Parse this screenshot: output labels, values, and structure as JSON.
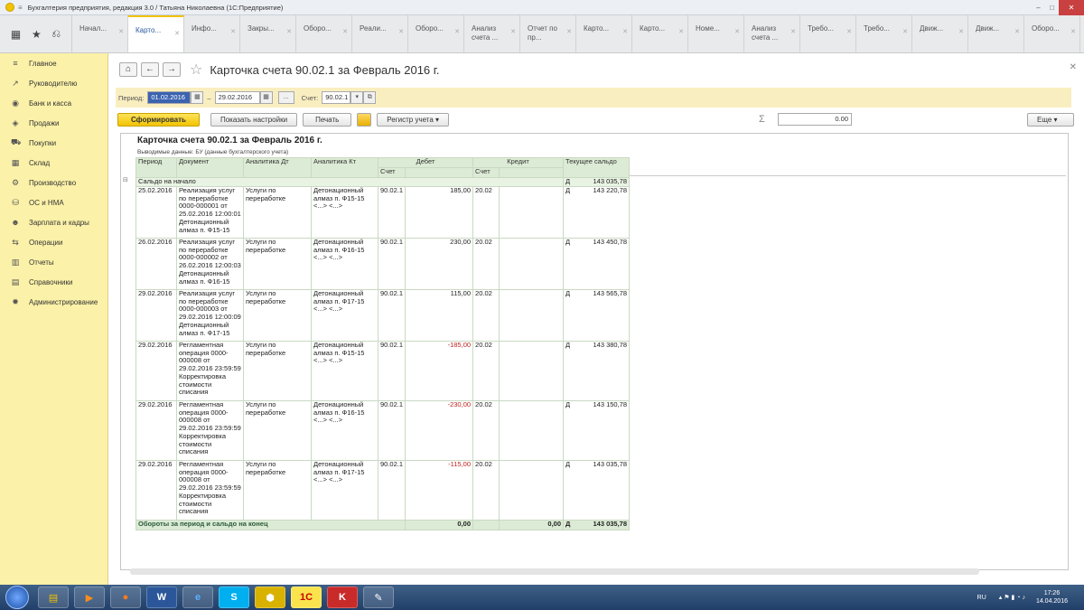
{
  "window": {
    "title": "Бухгалтерия предприятия, редакция 3.0 / Татьяна Николаевна  (1С:Предприятие)"
  },
  "tabs": [
    {
      "label": "Начал..."
    },
    {
      "label": "Картo..."
    },
    {
      "label": "Инфо..."
    },
    {
      "label": "Закры..."
    },
    {
      "label": "Оборо..."
    },
    {
      "label": "Реали..."
    },
    {
      "label": "Оборо..."
    },
    {
      "label": "Анализ счета ..."
    },
    {
      "label": "Отчет по пр..."
    },
    {
      "label": "Карто..."
    },
    {
      "label": "Карто..."
    },
    {
      "label": "Номе..."
    },
    {
      "label": "Анализ счета ..."
    },
    {
      "label": "Требо..."
    },
    {
      "label": "Требо..."
    },
    {
      "label": "Движ..."
    },
    {
      "label": "Движ..."
    },
    {
      "label": "Оборо..."
    }
  ],
  "sidebar": {
    "items": [
      {
        "label": "Главное",
        "icon": "menu-icon"
      },
      {
        "label": "Руководителю",
        "icon": "chart-icon"
      },
      {
        "label": "Банк и касса",
        "icon": "bank-icon"
      },
      {
        "label": "Продажи",
        "icon": "sales-icon"
      },
      {
        "label": "Покупки",
        "icon": "cart-icon"
      },
      {
        "label": "Склад",
        "icon": "warehouse-icon"
      },
      {
        "label": "Производство",
        "icon": "factory-icon"
      },
      {
        "label": "ОС и НМА",
        "icon": "assets-icon"
      },
      {
        "label": "Зарплата и кадры",
        "icon": "people-icon"
      },
      {
        "label": "Операции",
        "icon": "operations-icon"
      },
      {
        "label": "Отчеты",
        "icon": "reports-icon"
      },
      {
        "label": "Справочники",
        "icon": "book-icon"
      },
      {
        "label": "Администрирование",
        "icon": "gear-icon"
      }
    ]
  },
  "header": {
    "title": "Карточка счета 90.02.1 за Февраль 2016 г."
  },
  "params": {
    "period_label": "Период:",
    "date_from": "01.02.2016",
    "dash": "–",
    "date_to": "29.02.2016",
    "dots": "...",
    "account_label": "Счет:",
    "account": "90.02.1"
  },
  "toolbar": {
    "generate": "Сформировать",
    "show_settings": "Показать настройки",
    "print": "Печать",
    "register": "Регистр учета",
    "sum": "0.00",
    "more": "Еще"
  },
  "report": {
    "title": "Карточка счета 90.02.1 за Февраль 2016 г.",
    "subtitle": "Выводимые данные:  БУ (данные бухгалтерского учета)",
    "headers": {
      "period": "Период",
      "document": "Документ",
      "an_dt": "Аналитика Дт",
      "an_kt": "Аналитика Кт",
      "debit": "Дебет",
      "credit": "Кредит",
      "balance": "Текущее сальдо",
      "acc1": "Счет",
      "acc2": "Счет"
    },
    "opening": {
      "label": "Сальдо на начало",
      "dk": "Д",
      "value": "143 035,78"
    },
    "rows": [
      {
        "date": "25.02.2016",
        "doc": "Реализация услуг по переработке 0000-000001 от 25.02.2016 12:00:01 Детонационный алмаз п. Ф15-15",
        "andt": "Услуги по переработке",
        "ankt": "Детонационный алмаз п. Ф15-15 <...>  <...>",
        "dacc": "90.02.1",
        "dsum": "185,00",
        "kacc": "20.02",
        "ksum": "",
        "dk": "Д",
        "bal": "143 220,78"
      },
      {
        "date": "26.02.2016",
        "doc": "Реализация услуг по переработке 0000-000002 от 26.02.2016 12:00:03 Детонационный алмаз п. Ф16-15",
        "andt": "Услуги по переработке",
        "ankt": "Детонационный алмаз п. Ф16-15 <...>  <...>",
        "dacc": "90.02.1",
        "dsum": "230,00",
        "kacc": "20.02",
        "ksum": "",
        "dk": "Д",
        "bal": "143 450,78"
      },
      {
        "date": "29.02.2016",
        "doc": "Реализация услуг по переработке 0000-000003 от 29.02.2016 12:00:09 Детонационный алмаз п. Ф17-15",
        "andt": "Услуги по переработке",
        "ankt": "Детонационный алмаз п. Ф17-15 <...>  <...>",
        "dacc": "90.02.1",
        "dsum": "115,00",
        "kacc": "20.02",
        "ksum": "",
        "dk": "Д",
        "bal": "143 565,78"
      },
      {
        "date": "29.02.2016",
        "doc": "Регламентная операция 0000-000008 от 29.02.2016 23:59:59 Корректировка стоимости списания",
        "andt": "Услуги по переработке",
        "ankt": "Детонационный алмаз п. Ф15-15 <...>  <...>",
        "dacc": "90.02.1",
        "dsum": "-185,00",
        "kacc": "20.02",
        "ksum": "",
        "dk": "Д",
        "bal": "143 380,78"
      },
      {
        "date": "29.02.2016",
        "doc": "Регламентная операция 0000-000008 от 29.02.2016 23:59:59 Корректировка стоимости списания",
        "andt": "Услуги по переработке",
        "ankt": "Детонационный алмаз п. Ф16-15 <...>  <...>",
        "dacc": "90.02.1",
        "dsum": "-230,00",
        "kacc": "20.02",
        "ksum": "",
        "dk": "Д",
        "bal": "143 150,78"
      },
      {
        "date": "29.02.2016",
        "doc": "Регламентная операция 0000-000008 от 29.02.2016 23:59:59 Корректировка стоимости списания",
        "andt": "Услуги по переработке",
        "ankt": "Детонационный алмаз п. Ф17-15 <...>  <...>",
        "dacc": "90.02.1",
        "dsum": "-115,00",
        "kacc": "20.02",
        "ksum": "",
        "dk": "Д",
        "bal": "143 035,78"
      }
    ],
    "totals": {
      "label": "Обороты за период и сальдо на конец",
      "debit": "0,00",
      "credit": "0,00",
      "dk": "Д",
      "value": "143 035,78"
    }
  },
  "taskbar": {
    "lang": "RU",
    "time": "17:26",
    "date": "14.04.2016"
  }
}
